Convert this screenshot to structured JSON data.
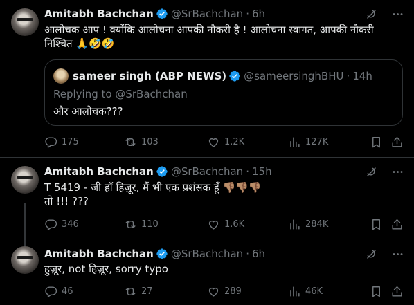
{
  "tweets": [
    {
      "author": "Amitabh Bachchan",
      "handle": "@SrBachchan",
      "time": "6h",
      "text_line1": "आलोचक आप ! क्योंकि आलोचना आपकी नौकरी है ! आलोचना स्वागत, आपकी नौकरी",
      "text_line2": "निश्चित 🙏🤣🤣",
      "stats": {
        "replies": "175",
        "retweets": "103",
        "likes": "1.2K",
        "views": "127K"
      }
    },
    {
      "author": "Amitabh Bachchan",
      "handle": "@SrBachchan",
      "time": "15h",
      "text_line1": "T 5419 - जी हाँ हिज़ूर, मैं भी एक प्रशंसक हूँ 👎🏽👎🏽👎🏽",
      "text_line2": "तो !!! ???",
      "stats": {
        "replies": "346",
        "retweets": "110",
        "likes": "1.6K",
        "views": "284K"
      }
    },
    {
      "author": "Amitabh Bachchan",
      "handle": "@SrBachchan",
      "time": "6h",
      "text_line1": "हुज़ूर, not हिज़ूर, sorry typo",
      "stats": {
        "replies": "46",
        "retweets": "27",
        "likes": "289",
        "views": "46K"
      }
    }
  ],
  "quote": {
    "author": "sameer singh (ABP NEWS)",
    "handle": "@sameersinghBHU",
    "time": "14h",
    "replying_prefix": "Replying to",
    "replying_to": "@SrBachchan",
    "text": "और आलोचक???"
  },
  "colors": {
    "background": "#000000",
    "text": "#e7e9ea",
    "muted": "#71767b",
    "verified": "#1d9bf0",
    "border": "#2f3336"
  },
  "icons": [
    "grok-icon",
    "more-icon",
    "reply-icon",
    "retweet-icon",
    "like-icon",
    "views-icon",
    "bookmark-icon",
    "share-icon",
    "verified-badge-icon"
  ]
}
